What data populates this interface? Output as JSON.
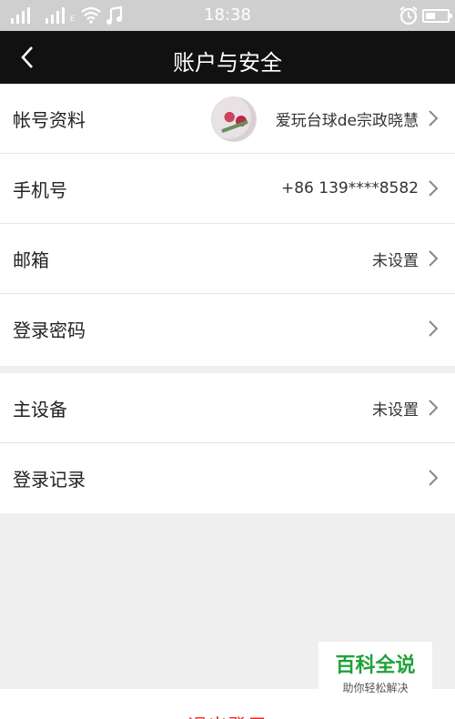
{
  "status_bar": {
    "time": "18:38",
    "signal_label": "E"
  },
  "nav": {
    "title": "账户与安全"
  },
  "rows_group1": [
    {
      "label": "帐号资料",
      "value": "爱玩台球de宗政晓慧"
    },
    {
      "label": "手机号",
      "value": "+86 139****8582"
    },
    {
      "label": "邮箱",
      "value": "未设置"
    },
    {
      "label": "登录密码",
      "value": ""
    }
  ],
  "rows_group2": [
    {
      "label": "主设备",
      "value": "未设置"
    },
    {
      "label": "登录记录",
      "value": ""
    }
  ],
  "watermark": {
    "title": "百科全说",
    "subtitle": "助你轻松解决"
  },
  "footer": {
    "logout_label": "退出登录"
  }
}
